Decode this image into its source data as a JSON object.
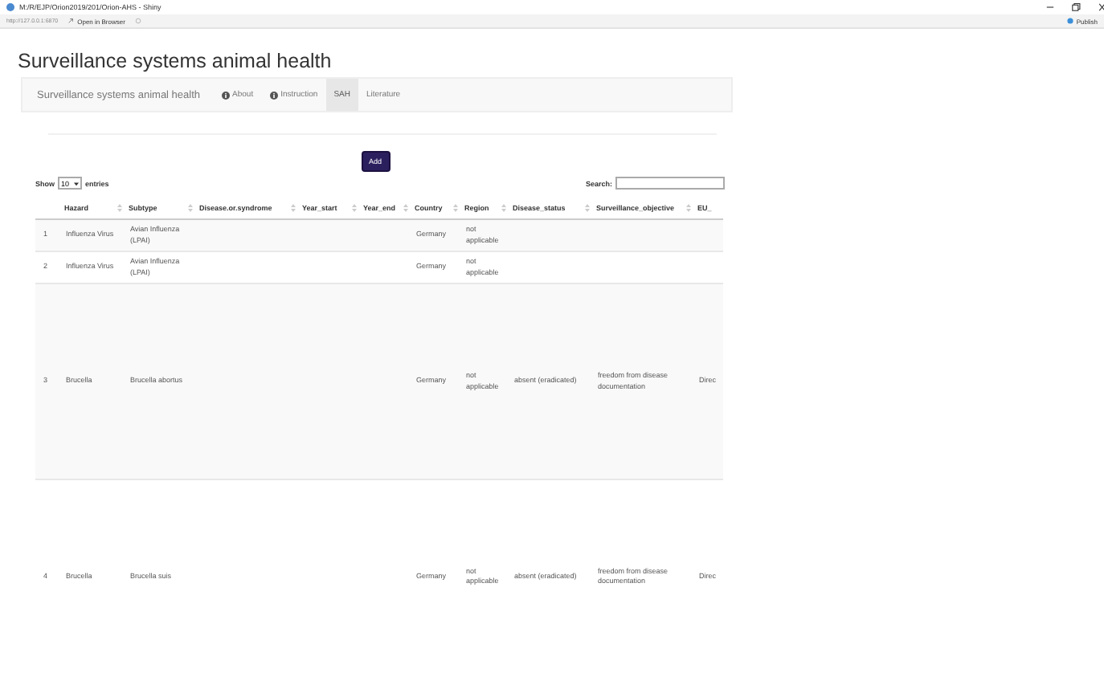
{
  "window": {
    "title": "M:/R/EJP/Orion2019/201/Orion-AHS - Shiny",
    "address": "http://127.0.0.1:6870",
    "open_button": "Open in Browser",
    "publish": "Publish"
  },
  "page_title": "Surveillance systems animal health",
  "navbar": {
    "brand": "Surveillance systems animal health",
    "items": [
      {
        "label": "About",
        "kind": "info",
        "selected": false
      },
      {
        "label": "Instruction",
        "kind": "info",
        "selected": false
      },
      {
        "label": "SAH",
        "kind": "plain",
        "selected": true
      },
      {
        "label": "Literature",
        "kind": "plain",
        "selected": false
      }
    ]
  },
  "add_button": "Add",
  "length_control": {
    "before": "Show",
    "value": "10",
    "after": "entries"
  },
  "search": {
    "label": "Search:"
  },
  "table": {
    "columns": [
      "",
      "Hazard",
      "Subtype",
      "Disease.or.syndrome",
      "Year_start",
      "Year_end",
      "Country",
      "Region",
      "Disease_status",
      "Surveillance_objective",
      "EU_"
    ],
    "rows": [
      [
        "1",
        "Influenza Virus",
        "Avian Influenza (LPAI)",
        "",
        "",
        "",
        "Germany",
        "not applicable",
        "",
        "",
        ""
      ],
      [
        "2",
        "Influenza Virus",
        "Avian Influenza (LPAI)",
        "",
        "",
        "",
        "Germany",
        "not applicable",
        "",
        "",
        ""
      ],
      [
        "3",
        "Brucella",
        "Brucella abortus",
        "",
        "",
        "",
        "Germany",
        "not applicable",
        "absent (eradicated)",
        "freedom from disease documentation",
        "Direc"
      ],
      [
        "4",
        "Brucella",
        "Brucella suis",
        "",
        "",
        "",
        "Germany",
        "not applicable",
        "absent (eradicated)",
        "freedom from disease documentation",
        "Direc"
      ]
    ]
  }
}
